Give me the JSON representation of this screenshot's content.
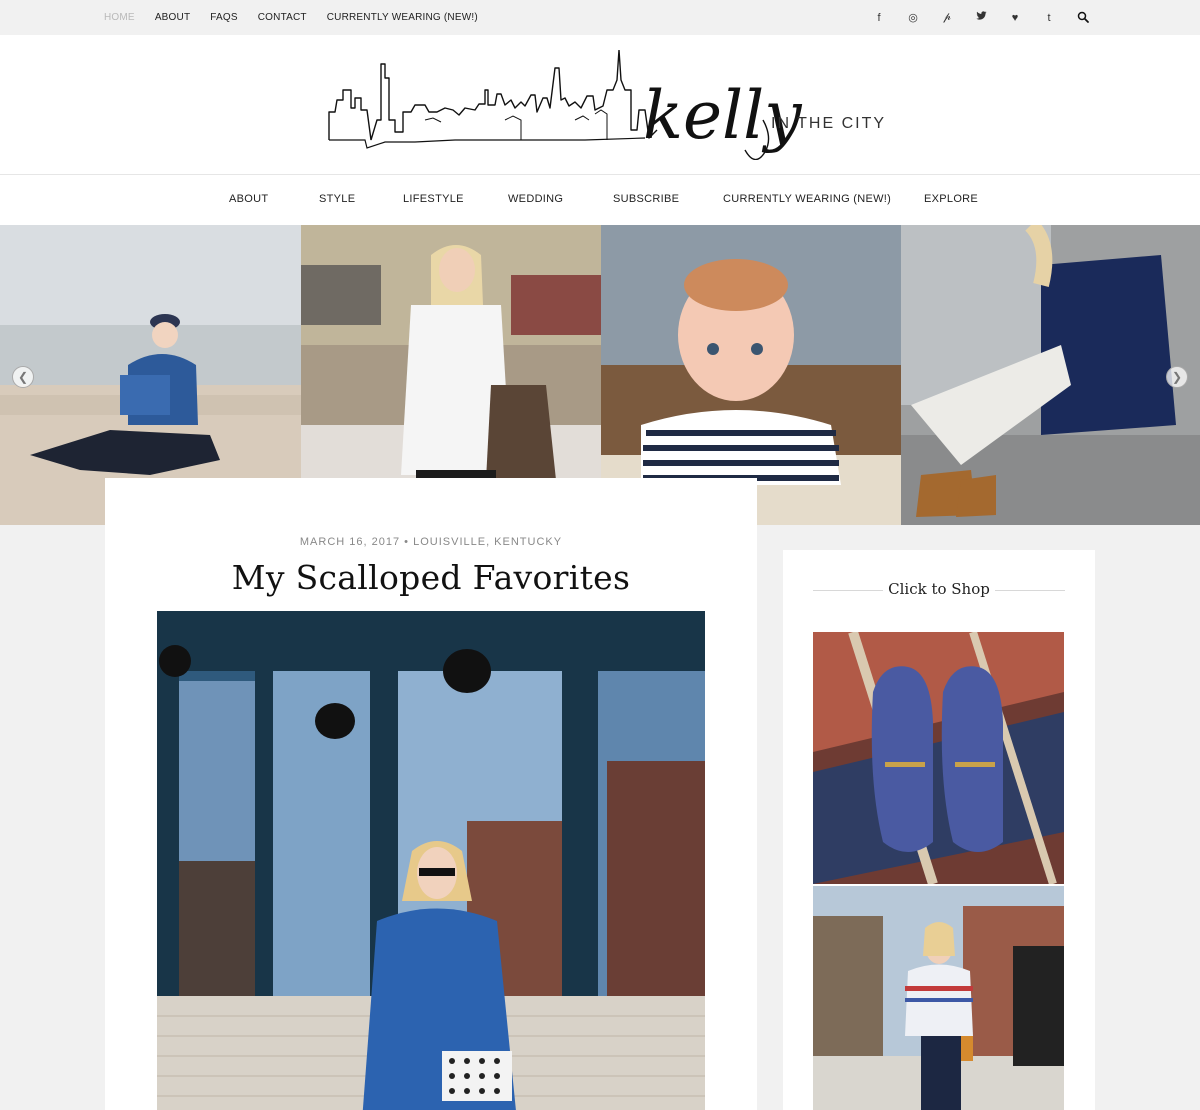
{
  "topbar": {
    "links": [
      {
        "label": "HOME"
      },
      {
        "label": "ABOUT"
      },
      {
        "label": "FAQS"
      },
      {
        "label": "CONTACT"
      },
      {
        "label": "CURRENTLY WEARING (NEW!)"
      }
    ],
    "social_icons": [
      "facebook-icon",
      "instagram-icon",
      "pinterest-icon",
      "twitter-icon",
      "bloglovin-heart-icon",
      "tumblr-icon",
      "search-icon"
    ],
    "social_glyphs": [
      "f",
      "◎",
      "𝓅",
      "🐦",
      "♥",
      "t",
      "⚲"
    ]
  },
  "logo": {
    "script": "kelly",
    "tagline": "IN THE CITY"
  },
  "mainnav": {
    "items": [
      {
        "label": "ABOUT"
      },
      {
        "label": "STYLE"
      },
      {
        "label": "LIFESTYLE"
      },
      {
        "label": "WEDDING"
      },
      {
        "label": "SUBSCRIBE"
      },
      {
        "label": "CURRENTLY WEARING (NEW!)"
      },
      {
        "label": "EXPLORE"
      }
    ]
  },
  "slider": {
    "prev_icon": "chevron-left-icon",
    "next_icon": "chevron-right-icon",
    "prev_glyph": "❮",
    "next_glyph": "❯"
  },
  "post": {
    "date": "MARCH 16, 2017",
    "separator": "•",
    "location": "LOUISVILLE, KENTUCKY",
    "title": "My Scalloped Favorites"
  },
  "sidebar": {
    "widget_title": "Click to Shop"
  },
  "colors": {
    "page_bg": "#f1f1f1",
    "card_bg": "#ffffff",
    "active_link": "#b9b9b9",
    "meta_text": "#888888"
  }
}
